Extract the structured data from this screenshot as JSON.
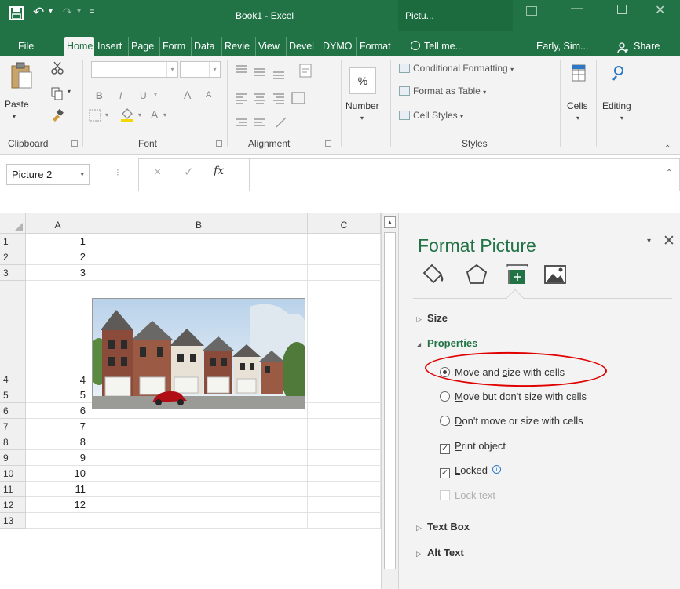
{
  "titlebar": {
    "title": "Book1 - Excel",
    "context_label": "Pictu...",
    "min_glyph": "—",
    "close_glyph": "✕",
    "undo_glyph": "↶",
    "redo_glyph": "↷",
    "arrow_glyph": "▾",
    "qa_more_glyph": "="
  },
  "tabs": [
    {
      "label": "File"
    },
    {
      "label": "Home",
      "active": true
    },
    {
      "label": "Insert"
    },
    {
      "label": "Page"
    },
    {
      "label": "Form"
    },
    {
      "label": "Data"
    },
    {
      "label": "Revie"
    },
    {
      "label": "View"
    },
    {
      "label": "Devel"
    },
    {
      "label": "DYMO"
    },
    {
      "label": "Format"
    },
    {
      "label": "Tell me..."
    },
    {
      "label": "Early, Sim..."
    },
    {
      "label": "Share"
    }
  ],
  "ribbon": {
    "groups": {
      "clipboard": "Clipboard",
      "font": "Font",
      "alignment": "Alignment",
      "styles": "Styles"
    },
    "paste_label": "Paste",
    "number_label": "Number",
    "number_glyph": "%",
    "cells_label": "Cells",
    "editing_label": "Editing",
    "styles_items": [
      "Conditional Formatting",
      "Format as Table",
      "Cell Styles"
    ],
    "font_glyphs": {
      "bold": "B",
      "italic": "I",
      "underline": "U",
      "grow": "A",
      "shrink": "A",
      "color": "A",
      "dd": "▾"
    }
  },
  "formula_bar": {
    "name_box": "Picture 2",
    "dd_glyph": "▾",
    "dots": "⁝",
    "cancel": "×",
    "enter": "✓",
    "fx": "fx",
    "expand": "⌃",
    "value": ""
  },
  "sheet": {
    "columns": [
      "A",
      "B",
      "C"
    ],
    "rows": [
      {
        "row": "1",
        "a": "1"
      },
      {
        "row": "2",
        "a": "2"
      },
      {
        "row": "3",
        "a": "3"
      },
      {
        "row": "4",
        "a": "4"
      },
      {
        "row": "5",
        "a": "5"
      },
      {
        "row": "6",
        "a": "6"
      },
      {
        "row": "7",
        "a": "7"
      },
      {
        "row": "8",
        "a": "8"
      },
      {
        "row": "9",
        "a": "9"
      },
      {
        "row": "10",
        "a": "10"
      },
      {
        "row": "11",
        "a": "11"
      },
      {
        "row": "12",
        "a": "12"
      },
      {
        "row": "13",
        "a": ""
      }
    ],
    "scroll_up": "▲"
  },
  "pane": {
    "title": "Format Picture",
    "options_glyph": "▾",
    "close_glyph": "✕",
    "sections": {
      "size": "Size",
      "properties": "Properties",
      "text_box": "Text Box",
      "alt_text": "Alt Text"
    },
    "arrow_closed": "▷",
    "arrow_open": "◢",
    "radios": {
      "move_size_pre": "Move and ",
      "move_size_u": "s",
      "move_size_post": "ize with cells",
      "move_no_size_pre": "",
      "move_no_size_u": "M",
      "move_no_size_post": "ove but don't size with cells",
      "no_move_pre": "",
      "no_move_u": "D",
      "no_move_post": "on't move or size with cells"
    },
    "checks": {
      "print_u": "P",
      "print_post": "rint object",
      "locked_u": "L",
      "locked_post": "ocked",
      "lock_text_pre": "Lock ",
      "lock_text_u": "t",
      "lock_text_post": "ext",
      "check_glyph": "✓",
      "info_glyph": "i"
    },
    "selected_radio": "move_and_size"
  },
  "colors": {
    "excel_green": "#217346",
    "annotation_red": "#e00000"
  }
}
